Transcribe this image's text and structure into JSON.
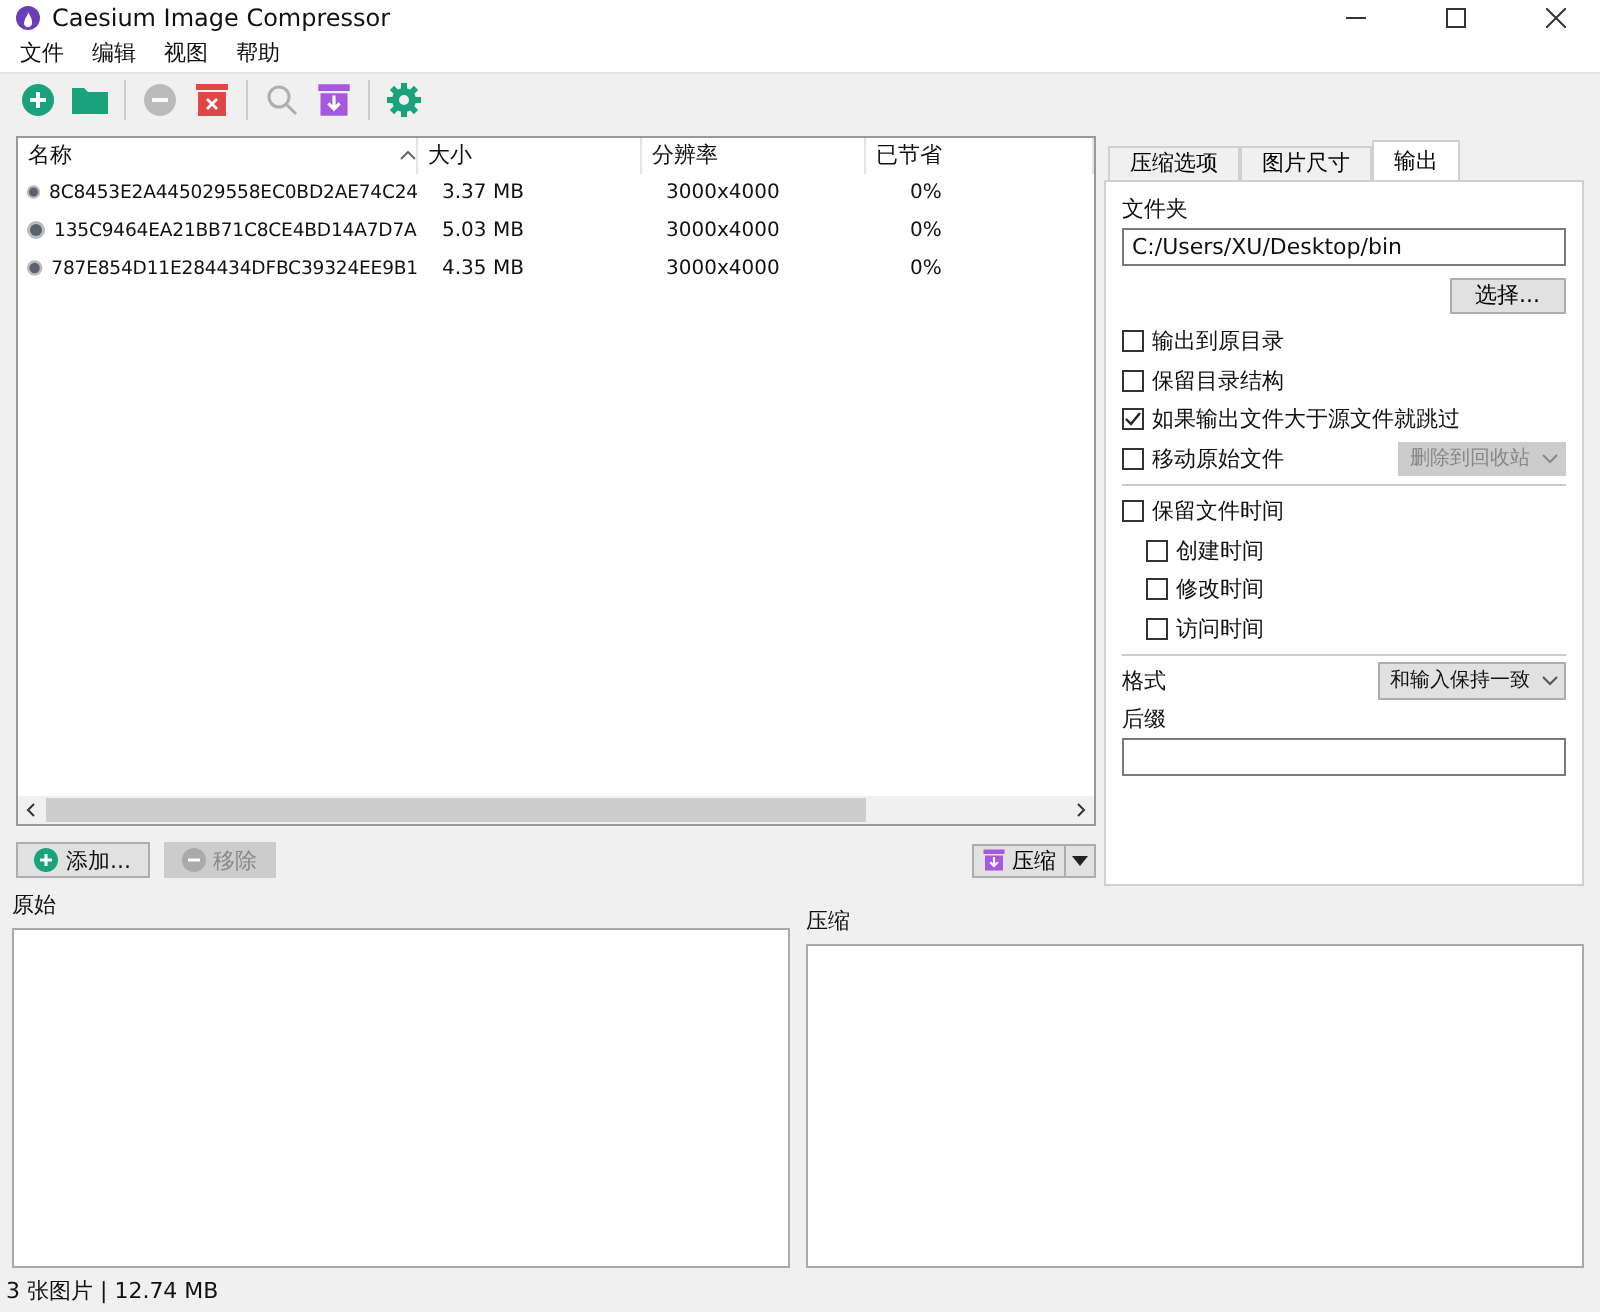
{
  "window": {
    "title": "Caesium Image Compressor"
  },
  "menu": [
    "文件",
    "编辑",
    "视图",
    "帮助"
  ],
  "toolbar": [
    {
      "kind": "add"
    },
    {
      "kind": "folder"
    },
    {
      "kind": "remove",
      "disabled": true
    },
    {
      "kind": "clear"
    },
    {
      "kind": "search",
      "disabled": true
    },
    {
      "kind": "compress"
    },
    {
      "kind": "settings"
    }
  ],
  "table": {
    "columns": [
      "名称",
      "大小",
      "分辨率",
      "已节省"
    ],
    "rows": [
      {
        "name": "8C8453E2A445029558EC0BD2AE74C24",
        "size": "3.37 MB",
        "resolution": "3000x4000",
        "saved": "0%"
      },
      {
        "name": "135C9464EA21BB71C8CE4BD14A7D7A",
        "size": "5.03 MB",
        "resolution": "3000x4000",
        "saved": "0%"
      },
      {
        "name": "787E854D11E284434DFBC39324EE9B1",
        "size": "4.35 MB",
        "resolution": "3000x4000",
        "saved": "0%"
      }
    ]
  },
  "list_buttons": [
    {
      "label": "添加...",
      "disabled": false
    },
    {
      "label": "移除",
      "disabled": true
    }
  ],
  "compress_button": "压缩",
  "tabs": [
    {
      "label": "压缩选项",
      "selected": false
    },
    {
      "label": "图片尺寸",
      "selected": false
    },
    {
      "label": "输出",
      "selected": true
    }
  ],
  "output": {
    "folder_label": "文件夹",
    "folder_value": "C:/Users/XU/Desktop/bin",
    "choose_button": "选择...",
    "options": [
      {
        "label": "输出到原目录",
        "checked": false
      },
      {
        "label": "保留目录结构",
        "checked": false
      },
      {
        "label": "如果输出文件大于源文件就跳过",
        "checked": true
      },
      {
        "label": "移动原始文件",
        "checked": false,
        "dropdown": "删除到回收站"
      }
    ],
    "keep_time": {
      "label": "保留文件时间",
      "checked": false,
      "children": [
        {
          "label": "创建时间",
          "checked": false
        },
        {
          "label": "修改时间",
          "checked": false
        },
        {
          "label": "访问时间",
          "checked": false
        }
      ]
    },
    "format_label": "格式",
    "format_value": "和输入保持一致",
    "suffix_label": "后缀"
  },
  "previews": [
    {
      "label": "原始"
    },
    {
      "label": "压缩"
    }
  ],
  "status_bar": "3 张图片 | 12.74 MB"
}
